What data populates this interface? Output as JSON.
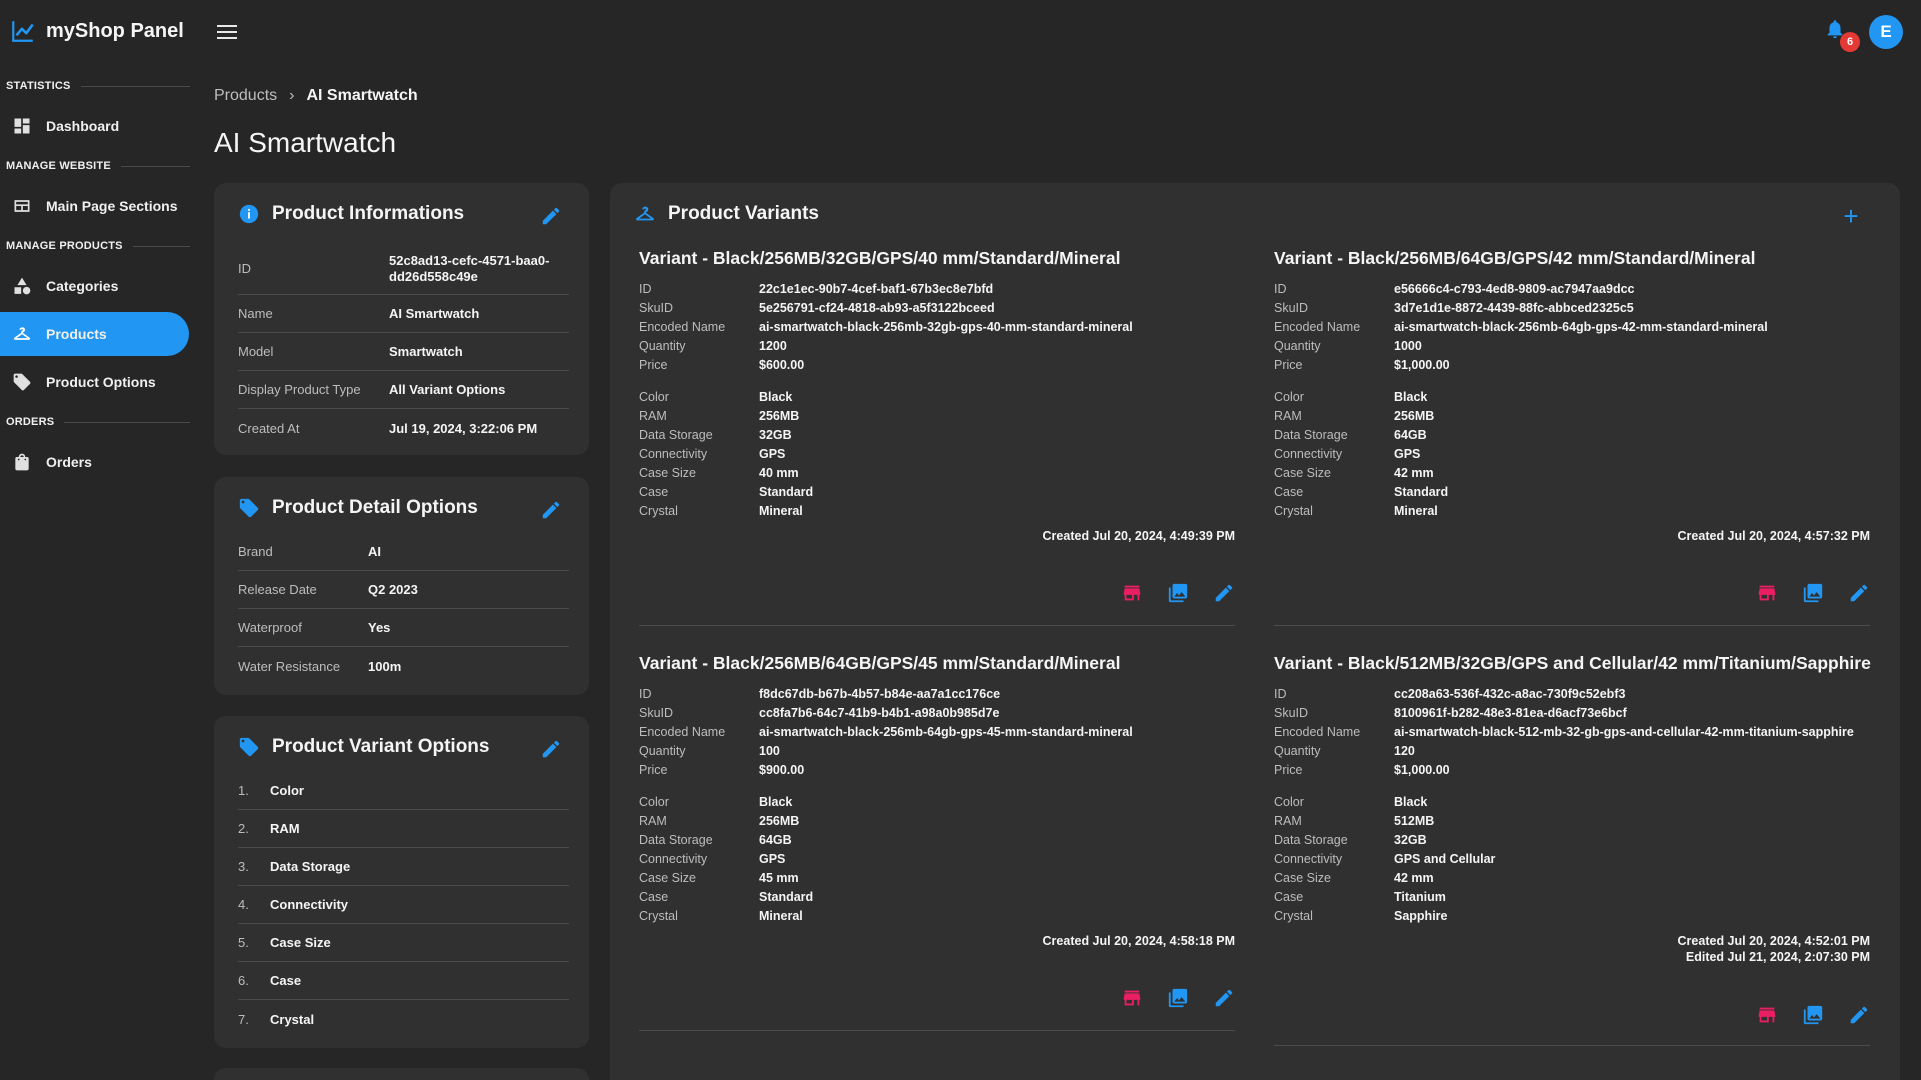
{
  "brand": {
    "title": "myShop Panel"
  },
  "header": {
    "notification_count": "6",
    "avatar_letter": "E"
  },
  "sidebar": {
    "section_statistics": "STATISTICS",
    "dashboard": "Dashboard",
    "section_manage_website": "MANAGE WEBSITE",
    "main_page_sections": "Main Page Sections",
    "section_manage_products": "MANAGE PRODUCTS",
    "categories": "Categories",
    "products": "Products",
    "product_options": "Product Options",
    "section_orders": "ORDERS",
    "orders": "Orders"
  },
  "breadcrumb": {
    "parent": "Products",
    "separator": "›",
    "current": "AI Smartwatch"
  },
  "page": {
    "title": "AI Smartwatch"
  },
  "product_info": {
    "title": "Product Informations",
    "rows": [
      {
        "k": "ID",
        "v": "52c8ad13-cefc-4571-baa0-dd26d558c49e"
      },
      {
        "k": "Name",
        "v": "AI Smartwatch"
      },
      {
        "k": "Model",
        "v": "Smartwatch"
      },
      {
        "k": "Display Product Type",
        "v": "All Variant Options"
      },
      {
        "k": "Created At",
        "v": "Jul 19, 2024, 3:22:06 PM"
      }
    ]
  },
  "detail_options": {
    "title": "Product Detail Options",
    "rows": [
      {
        "k": "Brand",
        "v": "AI"
      },
      {
        "k": "Release Date",
        "v": "Q2 2023"
      },
      {
        "k": "Waterproof",
        "v": "Yes"
      },
      {
        "k": "Water Resistance",
        "v": "100m"
      }
    ]
  },
  "variant_options": {
    "title": "Product Variant Options",
    "items": [
      {
        "n": "1.",
        "v": "Color"
      },
      {
        "n": "2.",
        "v": "RAM"
      },
      {
        "n": "3.",
        "v": "Data Storage"
      },
      {
        "n": "4.",
        "v": "Connectivity"
      },
      {
        "n": "5.",
        "v": "Case Size"
      },
      {
        "n": "6.",
        "v": "Case"
      },
      {
        "n": "7.",
        "v": "Crystal"
      }
    ]
  },
  "variants_panel": {
    "title": "Product Variants"
  },
  "variants": [
    {
      "title": "Variant - Black/256MB/32GB/GPS/40 mm/Standard/Mineral",
      "id": "22c1e1ec-90b7-4cef-baf1-67b3ec8e7bfd",
      "sku": "5e256791-cf24-4818-ab93-a5f3122bceed",
      "encoded": "ai-smartwatch-black-256mb-32gb-gps-40-mm-standard-mineral",
      "quantity": "1200",
      "price": "$600.00",
      "color": "Black",
      "ram": "256MB",
      "storage": "32GB",
      "connectivity": "GPS",
      "case_size": "40 mm",
      "case": "Standard",
      "crystal": "Mineral",
      "created": "Created Jul 20, 2024, 4:49:39 PM",
      "edited": ""
    },
    {
      "title": "Variant - Black/256MB/64GB/GPS/42 mm/Standard/Mineral",
      "id": "e56666c4-c793-4ed8-9809-ac7947aa9dcc",
      "sku": "3d7e1d1e-8872-4439-88fc-abbced2325c5",
      "encoded": "ai-smartwatch-black-256mb-64gb-gps-42-mm-standard-mineral",
      "quantity": "1000",
      "price": "$1,000.00",
      "color": "Black",
      "ram": "256MB",
      "storage": "64GB",
      "connectivity": "GPS",
      "case_size": "42 mm",
      "case": "Standard",
      "crystal": "Mineral",
      "created": "Created Jul 20, 2024, 4:57:32 PM",
      "edited": ""
    },
    {
      "title": "Variant - Black/256MB/64GB/GPS/45 mm/Standard/Mineral",
      "id": "f8dc67db-b67b-4b57-b84e-aa7a1cc176ce",
      "sku": "cc8fa7b6-64c7-41b9-b4b1-a98a0b985d7e",
      "encoded": "ai-smartwatch-black-256mb-64gb-gps-45-mm-standard-mineral",
      "quantity": "100",
      "price": "$900.00",
      "color": "Black",
      "ram": "256MB",
      "storage": "64GB",
      "connectivity": "GPS",
      "case_size": "45 mm",
      "case": "Standard",
      "crystal": "Mineral",
      "created": "Created Jul 20, 2024, 4:58:18 PM",
      "edited": ""
    },
    {
      "title": "Variant - Black/512MB/32GB/GPS and Cellular/42 mm/Titanium/Sapphire",
      "id": "cc208a63-536f-432c-a8ac-730f9c52ebf3",
      "sku": "8100961f-b282-48e3-81ea-d6acf73e6bcf",
      "encoded": "ai-smartwatch-black-512-mb-32-gb-gps-and-cellular-42-mm-titanium-sapphire",
      "quantity": "120",
      "price": "$1,000.00",
      "color": "Black",
      "ram": "512MB",
      "storage": "32GB",
      "connectivity": "GPS and Cellular",
      "case_size": "42 mm",
      "case": "Titanium",
      "crystal": "Sapphire",
      "created": "Created Jul 20, 2024, 4:52:01 PM",
      "edited": "Edited Jul 21, 2024, 2:07:30 PM"
    }
  ],
  "variant_labels": {
    "id": "ID",
    "sku": "SkuID",
    "encoded": "Encoded Name",
    "quantity": "Quantity",
    "price": "Price",
    "color": "Color",
    "ram": "RAM",
    "storage": "Data Storage",
    "connectivity": "Connectivity",
    "case_size": "Case Size",
    "case": "Case",
    "crystal": "Crystal"
  },
  "colors": {
    "accent": "#2196f3",
    "danger": "#e91e63",
    "background": "#262626",
    "card": "#303030"
  },
  "icons": {
    "info": "info-icon",
    "edit": "pencil-icon",
    "tags": "tags-icon",
    "hanger": "hanger-icon",
    "store": "store-icon",
    "image": "image-icon",
    "add": "plus-icon"
  }
}
